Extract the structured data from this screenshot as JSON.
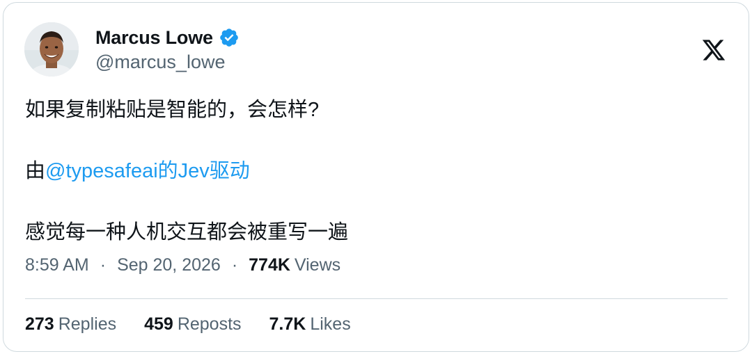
{
  "author": {
    "name": "Marcus Lowe",
    "handle": "@marcus_lowe",
    "verified": true,
    "avatar": "person-avatar-icon"
  },
  "platform_icon": "x-logo-icon",
  "tweet": {
    "line1": "如果复制粘贴是智能的，会怎样?",
    "line2_prefix": "由",
    "line2_mention": "@typesafeai的Jev驱动",
    "line3": "感觉每一种人机交互都会被重写一遍"
  },
  "meta": {
    "time": "8:59 AM",
    "date": "Sep 20, 2026",
    "separator": "·",
    "views_count": "774K",
    "views_label": "Views"
  },
  "stats": {
    "replies_count": "273",
    "replies_label": "Replies",
    "reposts_count": "459",
    "reposts_label": "Reposts",
    "likes_count": "7.7K",
    "likes_label": "Likes"
  },
  "colors": {
    "text": "#0f1419",
    "secondary": "#536471",
    "accent": "#1d9bf0",
    "border": "#cfd9de"
  }
}
